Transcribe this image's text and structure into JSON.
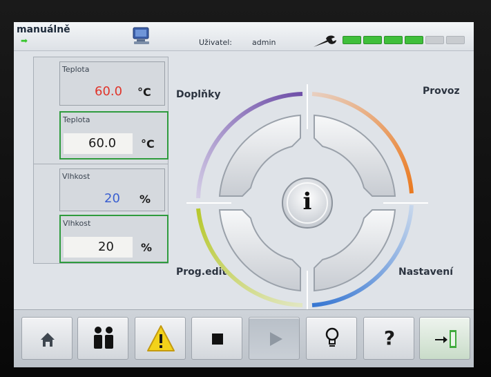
{
  "header": {
    "mode": "manuálně",
    "user_label": "Uživatel:",
    "user_value": "admin",
    "led_colors": [
      "#3fbf3a",
      "#3fbf3a",
      "#3fbf3a",
      "#3fbf3a",
      "#c9ccd0",
      "#c9ccd0"
    ]
  },
  "temperature": {
    "actual_label": "Teplota",
    "actual_value": "60.0",
    "actual_unit": "°C",
    "set_label": "Teplota",
    "set_value": "60.0",
    "set_unit": "°C"
  },
  "humidity": {
    "actual_label": "Vlhkost",
    "actual_value": "20",
    "actual_unit": "%",
    "set_label": "Vlhkost",
    "set_value": "20",
    "set_unit": "%"
  },
  "wheel": {
    "top_left": "Doplňky",
    "top_right": "Provoz",
    "bottom_left": "Prog.edit.",
    "bottom_right": "Nastavení",
    "center_glyph": "i"
  },
  "toolbar": {
    "help_glyph": "?",
    "icons": [
      "home-icon",
      "users-icon",
      "warning-icon",
      "stop-icon",
      "play-icon",
      "lightbulb-icon",
      "help-icon",
      "exit-icon"
    ]
  },
  "colors": {
    "actual_temp": "#e0342a",
    "actual_humidity": "#3a5fd0",
    "accent_green": "#2e9b3d"
  }
}
